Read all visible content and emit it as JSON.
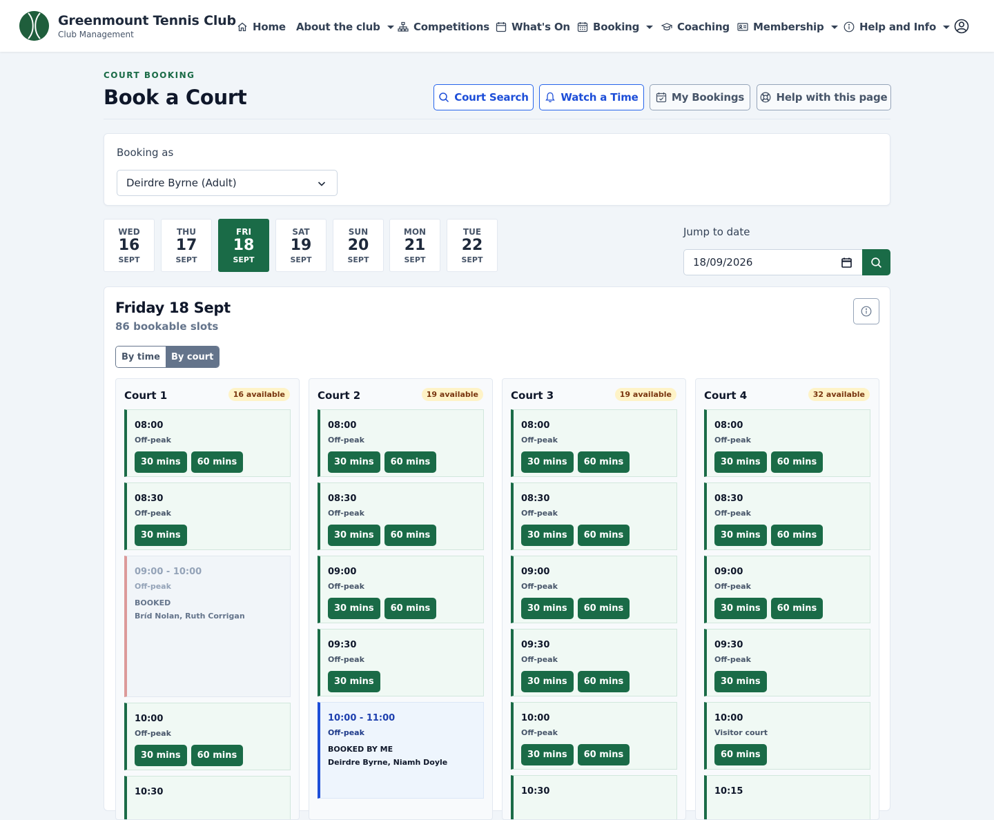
{
  "brand": {
    "name": "Greenmount Tennis Club",
    "subtitle": "Club Management"
  },
  "nav": {
    "home": "Home",
    "about": "About the club",
    "competitions": "Competitions",
    "whats_on": "What's On",
    "booking": "Booking",
    "coaching": "Coaching",
    "membership": "Membership",
    "help": "Help and Info"
  },
  "header": {
    "eyebrow": "COURT BOOKING",
    "title": "Book a Court",
    "court_search": "Court Search",
    "watch_time": "Watch a Time",
    "my_bookings": "My Bookings",
    "help_page": "Help with this page"
  },
  "booking_as": {
    "label": "Booking as",
    "value": "Deirdre Byrne (Adult)"
  },
  "days": [
    {
      "dow": "WED",
      "num": "16",
      "mon": "SEPT"
    },
    {
      "dow": "THU",
      "num": "17",
      "mon": "SEPT"
    },
    {
      "dow": "FRI",
      "num": "18",
      "mon": "SEPT"
    },
    {
      "dow": "SAT",
      "num": "19",
      "mon": "SEPT"
    },
    {
      "dow": "SUN",
      "num": "20",
      "mon": "SEPT"
    },
    {
      "dow": "MON",
      "num": "21",
      "mon": "SEPT"
    },
    {
      "dow": "TUE",
      "num": "22",
      "mon": "SEPT"
    }
  ],
  "selected_day_index": 2,
  "jump": {
    "label": "Jump to date",
    "value": "18/09/2026"
  },
  "day_panel": {
    "title": "Friday 18 Sept",
    "subtitle": "86 bookable slots",
    "view_by_time": "By time",
    "view_by_court": "By court"
  },
  "courts": [
    {
      "name": "Court 1",
      "badge": "16 available",
      "slots": [
        {
          "time": "08:00",
          "band": "Off-peak",
          "kind": "open",
          "durations": [
            "30 mins",
            "60 mins"
          ]
        },
        {
          "time": "08:30",
          "band": "Off-peak",
          "kind": "open",
          "durations": [
            "30 mins"
          ]
        },
        {
          "time": "09:00 - 10:00",
          "band": "Off-peak",
          "kind": "booked",
          "status": "BOOKED",
          "players": "Bríd Nolan, Ruth Corrigan"
        },
        {
          "time": "10:00",
          "band": "Off-peak",
          "kind": "open",
          "durations": [
            "30 mins",
            "60 mins"
          ]
        },
        {
          "time": "10:30",
          "band": "",
          "kind": "open",
          "durations": []
        }
      ]
    },
    {
      "name": "Court 2",
      "badge": "19 available",
      "slots": [
        {
          "time": "08:00",
          "band": "Off-peak",
          "kind": "open",
          "durations": [
            "30 mins",
            "60 mins"
          ]
        },
        {
          "time": "08:30",
          "band": "Off-peak",
          "kind": "open",
          "durations": [
            "30 mins",
            "60 mins"
          ]
        },
        {
          "time": "09:00",
          "band": "Off-peak",
          "kind": "open",
          "durations": [
            "30 mins",
            "60 mins"
          ]
        },
        {
          "time": "09:30",
          "band": "Off-peak",
          "kind": "open",
          "durations": [
            "30 mins"
          ]
        },
        {
          "time": "10:00 - 11:00",
          "band": "Off-peak",
          "kind": "mine",
          "status": "BOOKED BY ME",
          "players": "Deirdre Byrne, Niamh Doyle"
        }
      ]
    },
    {
      "name": "Court 3",
      "badge": "19 available",
      "slots": [
        {
          "time": "08:00",
          "band": "Off-peak",
          "kind": "open",
          "durations": [
            "30 mins",
            "60 mins"
          ]
        },
        {
          "time": "08:30",
          "band": "Off-peak",
          "kind": "open",
          "durations": [
            "30 mins",
            "60 mins"
          ]
        },
        {
          "time": "09:00",
          "band": "Off-peak",
          "kind": "open",
          "durations": [
            "30 mins",
            "60 mins"
          ]
        },
        {
          "time": "09:30",
          "band": "Off-peak",
          "kind": "open",
          "durations": [
            "30 mins",
            "60 mins"
          ]
        },
        {
          "time": "10:00",
          "band": "Off-peak",
          "kind": "open",
          "durations": [
            "30 mins",
            "60 mins"
          ]
        },
        {
          "time": "10:30",
          "band": "",
          "kind": "open",
          "durations": []
        }
      ]
    },
    {
      "name": "Court 4",
      "badge": "32 available",
      "slots": [
        {
          "time": "08:00",
          "band": "Off-peak",
          "kind": "open",
          "durations": [
            "30 mins",
            "60 mins"
          ]
        },
        {
          "time": "08:30",
          "band": "Off-peak",
          "kind": "open",
          "durations": [
            "30 mins",
            "60 mins"
          ]
        },
        {
          "time": "09:00",
          "band": "Off-peak",
          "kind": "open",
          "durations": [
            "30 mins",
            "60 mins"
          ]
        },
        {
          "time": "09:30",
          "band": "Off-peak",
          "kind": "open",
          "durations": [
            "30 mins"
          ]
        },
        {
          "time": "10:00",
          "band": "Visitor court",
          "kind": "open",
          "durations": [
            "60 mins"
          ]
        },
        {
          "time": "10:15",
          "band": "",
          "kind": "open",
          "durations": []
        }
      ]
    }
  ],
  "colors": {
    "brand_green": "#1a6b47",
    "available_badge": "#fef3c7",
    "booked_accent": "#dc9a9a",
    "mine_accent": "#1d4ed8"
  }
}
